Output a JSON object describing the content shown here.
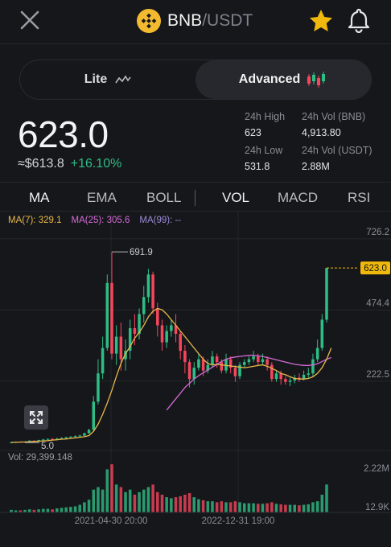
{
  "pair": {
    "base": "BNB",
    "quote": "/USDT"
  },
  "icons": {
    "close": "close-icon",
    "star": "star-icon",
    "bell": "bell-icon",
    "logo": "bnb-logo-icon",
    "expand": "expand-icon"
  },
  "colors": {
    "up": "#2ebd85",
    "down": "#f6465d",
    "star": "#f0b90b",
    "ma7": "#e9b84a",
    "ma25": "#d46bd6",
    "ma99": "#9b8ad8",
    "background": "#16171b"
  },
  "mode": {
    "lite": "Lite",
    "advanced": "Advanced",
    "selected": "Advanced"
  },
  "ticker": {
    "price": "623.0",
    "fiat": "≈$613.8",
    "change": "+16.10%"
  },
  "stats": {
    "high_label": "24h High",
    "high": "623",
    "vol_base_label": "24h Vol (BNB)",
    "vol_base": "4,913.80",
    "low_label": "24h Low",
    "low": "531.8",
    "vol_quote_label": "24h Vol (USDT)",
    "vol_quote": "2.88M"
  },
  "indicators": {
    "main": [
      "MA",
      "EMA",
      "BOLL"
    ],
    "sub": [
      "VOL",
      "MACD",
      "RSI"
    ],
    "active_main": "MA",
    "active_sub": "VOL"
  },
  "ma_legend": {
    "ma7": "MA(7): 329.1",
    "ma25": "MA(25): 305.6",
    "ma99": "MA(99): --"
  },
  "volume_label": "Vol: 29,399.148",
  "chart_data": {
    "type": "candlestick",
    "y_ticks": [
      "726.2",
      "474.4",
      "222.5"
    ],
    "y_ticks_values": [
      726.2,
      474.4,
      222.5
    ],
    "ylim": [
      0,
      760
    ],
    "current_price_label": "623.0",
    "current_price": 623.0,
    "high_marker": "691.9",
    "high_value": 691.9,
    "low_marker": "5.0",
    "low_value": 5.0,
    "x_ticks": [
      "2021-04-30 20:00",
      "2022-12-31 19:00"
    ],
    "volume_ticks": [
      "2.22M",
      "12.9K"
    ],
    "candles": [
      {
        "o": 5,
        "c": 6,
        "h": 8,
        "l": 4,
        "v": 0.05
      },
      {
        "o": 6,
        "c": 8,
        "h": 9,
        "l": 5,
        "v": 0.04
      },
      {
        "o": 8,
        "c": 7,
        "h": 9,
        "l": 6,
        "v": 0.04
      },
      {
        "o": 7,
        "c": 9,
        "h": 10,
        "l": 6,
        "v": 0.05
      },
      {
        "o": 9,
        "c": 12,
        "h": 13,
        "l": 8,
        "v": 0.06
      },
      {
        "o": 12,
        "c": 11,
        "h": 13,
        "l": 10,
        "v": 0.05
      },
      {
        "o": 11,
        "c": 14,
        "h": 15,
        "l": 10,
        "v": 0.06
      },
      {
        "o": 14,
        "c": 16,
        "h": 18,
        "l": 13,
        "v": 0.07
      },
      {
        "o": 16,
        "c": 18,
        "h": 20,
        "l": 15,
        "v": 0.07
      },
      {
        "o": 18,
        "c": 17,
        "h": 21,
        "l": 15,
        "v": 0.06
      },
      {
        "o": 17,
        "c": 19,
        "h": 22,
        "l": 16,
        "v": 0.08
      },
      {
        "o": 19,
        "c": 21,
        "h": 24,
        "l": 18,
        "v": 0.09
      },
      {
        "o": 21,
        "c": 24,
        "h": 26,
        "l": 20,
        "v": 0.1
      },
      {
        "o": 24,
        "c": 26,
        "h": 28,
        "l": 22,
        "v": 0.11
      },
      {
        "o": 26,
        "c": 28,
        "h": 31,
        "l": 25,
        "v": 0.12
      },
      {
        "o": 28,
        "c": 30,
        "h": 33,
        "l": 26,
        "v": 0.15
      },
      {
        "o": 30,
        "c": 38,
        "h": 40,
        "l": 28,
        "v": 0.2
      },
      {
        "o": 38,
        "c": 50,
        "h": 54,
        "l": 36,
        "v": 0.25
      },
      {
        "o": 50,
        "c": 150,
        "h": 170,
        "l": 48,
        "v": 0.45
      },
      {
        "o": 150,
        "c": 250,
        "h": 300,
        "l": 140,
        "v": 0.5
      },
      {
        "o": 250,
        "c": 340,
        "h": 380,
        "l": 230,
        "v": 0.45
      },
      {
        "o": 340,
        "c": 570,
        "h": 600,
        "l": 330,
        "v": 0.85
      },
      {
        "o": 570,
        "c": 320,
        "h": 680,
        "l": 300,
        "v": 0.95
      },
      {
        "o": 320,
        "c": 380,
        "h": 420,
        "l": 280,
        "v": 0.55
      },
      {
        "o": 380,
        "c": 300,
        "h": 430,
        "l": 260,
        "v": 0.5
      },
      {
        "o": 300,
        "c": 330,
        "h": 370,
        "l": 260,
        "v": 0.4
      },
      {
        "o": 330,
        "c": 410,
        "h": 440,
        "l": 300,
        "v": 0.45
      },
      {
        "o": 410,
        "c": 390,
        "h": 460,
        "l": 350,
        "v": 0.35
      },
      {
        "o": 390,
        "c": 460,
        "h": 480,
        "l": 370,
        "v": 0.4
      },
      {
        "o": 460,
        "c": 520,
        "h": 560,
        "l": 430,
        "v": 0.45
      },
      {
        "o": 520,
        "c": 600,
        "h": 620,
        "l": 500,
        "v": 0.5
      },
      {
        "o": 600,
        "c": 480,
        "h": 610,
        "l": 460,
        "v": 0.55
      },
      {
        "o": 480,
        "c": 420,
        "h": 500,
        "l": 380,
        "v": 0.4
      },
      {
        "o": 420,
        "c": 360,
        "h": 440,
        "l": 330,
        "v": 0.35
      },
      {
        "o": 360,
        "c": 400,
        "h": 420,
        "l": 340,
        "v": 0.3
      },
      {
        "o": 400,
        "c": 420,
        "h": 440,
        "l": 380,
        "v": 0.28
      },
      {
        "o": 420,
        "c": 390,
        "h": 460,
        "l": 360,
        "v": 0.3
      },
      {
        "o": 390,
        "c": 330,
        "h": 400,
        "l": 300,
        "v": 0.32
      },
      {
        "o": 330,
        "c": 290,
        "h": 350,
        "l": 250,
        "v": 0.35
      },
      {
        "o": 290,
        "c": 230,
        "h": 300,
        "l": 200,
        "v": 0.38
      },
      {
        "o": 230,
        "c": 270,
        "h": 290,
        "l": 210,
        "v": 0.3
      },
      {
        "o": 270,
        "c": 300,
        "h": 320,
        "l": 260,
        "v": 0.26
      },
      {
        "o": 300,
        "c": 260,
        "h": 310,
        "l": 240,
        "v": 0.24
      },
      {
        "o": 260,
        "c": 280,
        "h": 300,
        "l": 250,
        "v": 0.22
      },
      {
        "o": 280,
        "c": 310,
        "h": 330,
        "l": 270,
        "v": 0.22
      },
      {
        "o": 310,
        "c": 290,
        "h": 320,
        "l": 270,
        "v": 0.2
      },
      {
        "o": 290,
        "c": 260,
        "h": 300,
        "l": 250,
        "v": 0.22
      },
      {
        "o": 260,
        "c": 300,
        "h": 320,
        "l": 250,
        "v": 0.2
      },
      {
        "o": 300,
        "c": 270,
        "h": 310,
        "l": 250,
        "v": 0.2
      },
      {
        "o": 270,
        "c": 240,
        "h": 280,
        "l": 220,
        "v": 0.22
      },
      {
        "o": 240,
        "c": 280,
        "h": 290,
        "l": 230,
        "v": 0.2
      },
      {
        "o": 280,
        "c": 290,
        "h": 300,
        "l": 270,
        "v": 0.18
      },
      {
        "o": 290,
        "c": 300,
        "h": 310,
        "l": 280,
        "v": 0.18
      },
      {
        "o": 300,
        "c": 310,
        "h": 330,
        "l": 290,
        "v": 0.18
      },
      {
        "o": 310,
        "c": 290,
        "h": 320,
        "l": 280,
        "v": 0.17
      },
      {
        "o": 290,
        "c": 300,
        "h": 320,
        "l": 280,
        "v": 0.17
      },
      {
        "o": 300,
        "c": 280,
        "h": 310,
        "l": 260,
        "v": 0.18
      },
      {
        "o": 280,
        "c": 230,
        "h": 290,
        "l": 220,
        "v": 0.2
      },
      {
        "o": 230,
        "c": 250,
        "h": 260,
        "l": 220,
        "v": 0.17
      },
      {
        "o": 250,
        "c": 230,
        "h": 260,
        "l": 210,
        "v": 0.16
      },
      {
        "o": 230,
        "c": 220,
        "h": 240,
        "l": 210,
        "v": 0.15
      },
      {
        "o": 220,
        "c": 225,
        "h": 235,
        "l": 205,
        "v": 0.15
      },
      {
        "o": 225,
        "c": 235,
        "h": 245,
        "l": 215,
        "v": 0.15
      },
      {
        "o": 235,
        "c": 230,
        "h": 250,
        "l": 220,
        "v": 0.14
      },
      {
        "o": 230,
        "c": 245,
        "h": 260,
        "l": 225,
        "v": 0.15
      },
      {
        "o": 245,
        "c": 250,
        "h": 270,
        "l": 235,
        "v": 0.16
      },
      {
        "o": 250,
        "c": 300,
        "h": 320,
        "l": 240,
        "v": 0.2
      },
      {
        "o": 300,
        "c": 340,
        "h": 370,
        "l": 290,
        "v": 0.22
      },
      {
        "o": 340,
        "c": 440,
        "h": 460,
        "l": 330,
        "v": 0.35
      },
      {
        "o": 440,
        "c": 623,
        "h": 623,
        "l": 430,
        "v": 0.55
      }
    ],
    "ma7": [
      6,
      6,
      7,
      7,
      8,
      9,
      10,
      11,
      12,
      14,
      15,
      17,
      18,
      20,
      22,
      24,
      26,
      30,
      45,
      70,
      105,
      145,
      190,
      240,
      285,
      320,
      345,
      375,
      395,
      420,
      450,
      470,
      480,
      475,
      460,
      440,
      420,
      400,
      380,
      360,
      340,
      320,
      300,
      285,
      280,
      282,
      280,
      278,
      276,
      274,
      272,
      270,
      272,
      275,
      278,
      280,
      275,
      268,
      260,
      250,
      245,
      238,
      232,
      230,
      230,
      232,
      238,
      250,
      270,
      300,
      340
    ],
    "ma25": [
      null,
      null,
      null,
      null,
      null,
      null,
      null,
      null,
      null,
      null,
      null,
      null,
      null,
      null,
      null,
      null,
      null,
      null,
      null,
      null,
      null,
      null,
      null,
      null,
      null,
      null,
      null,
      null,
      null,
      null,
      null,
      null,
      null,
      null,
      120,
      140,
      160,
      180,
      200,
      215,
      230,
      242,
      252,
      262,
      272,
      282,
      292,
      300,
      305,
      308,
      310,
      312,
      314,
      314,
      312,
      310,
      306,
      302,
      298,
      294,
      290,
      286,
      282,
      280,
      278,
      278,
      280,
      284,
      292,
      300,
      306
    ]
  }
}
